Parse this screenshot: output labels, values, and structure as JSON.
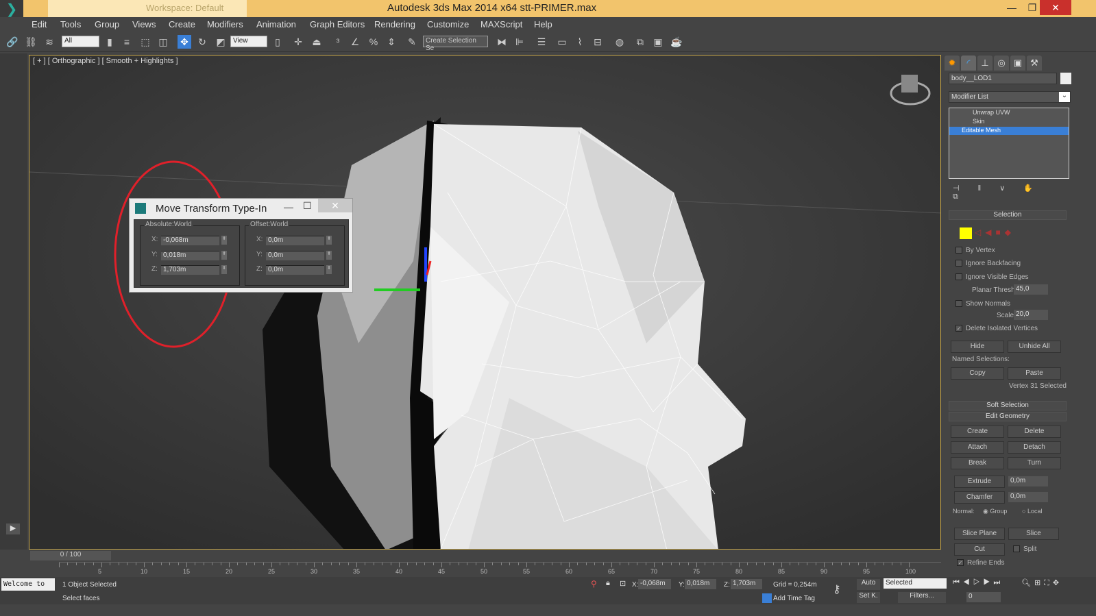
{
  "app": {
    "title": "Autodesk 3ds Max  2014 x64    stt-PRIMER.max",
    "workspace": "Workspace: Default"
  },
  "menu": [
    "Edit",
    "Tools",
    "Group",
    "Views",
    "Create",
    "Modifiers",
    "Animation",
    "Graph Editors",
    "Rendering",
    "Customize",
    "MAXScript",
    "Help"
  ],
  "toolbar": {
    "filter": "All",
    "ref_coord": "View",
    "named_sel": "Create Selection Se"
  },
  "viewport": {
    "label": "[ + ] [ Orthographic ] [ Smooth + Highlights ]"
  },
  "dialog": {
    "title": "Move Transform Type-In",
    "absolute": {
      "label": "Absolute:World",
      "x": "-0,068m",
      "y": "0,018m",
      "z": "1,703m"
    },
    "offset": {
      "label": "Offset:World",
      "x": "0,0m",
      "y": "0,0m",
      "z": "0,0m"
    },
    "axes": [
      "X:",
      "Y:",
      "Z:"
    ]
  },
  "panel": {
    "object_name": "body__LOD1",
    "modifier_list": "Modifier List",
    "stack": [
      "Unwrap UVW",
      "Skin",
      "Editable Mesh"
    ],
    "selection": {
      "title": "Selection",
      "by_vertex": "By Vertex",
      "ignore_backfacing": "Ignore Backfacing",
      "ignore_visible": "Ignore Visible Edges",
      "planar_label": "Planar Thresh:",
      "planar": "45,0",
      "show_normals": "Show Normals",
      "scale_label": "Scale:",
      "scale": "20,0",
      "delete_isolated": "Delete Isolated Vertices",
      "hide": "Hide",
      "unhide": "Unhide All",
      "named": "Named Selections:",
      "copy": "Copy",
      "paste": "Paste",
      "status": "Vertex 31 Selected"
    },
    "soft_selection": "Soft Selection",
    "edit_geometry": {
      "title": "Edit Geometry",
      "buttons": [
        "Create",
        "Delete",
        "Attach",
        "Detach",
        "Break",
        "Turn"
      ],
      "extrude": "Extrude",
      "extrude_val": "0,0m",
      "chamfer": "Chamfer",
      "chamfer_val": "0,0m",
      "normal": "Normal:",
      "group": "Group",
      "local": "Local",
      "slice_plane": "Slice Plane",
      "slice": "Slice",
      "cut": "Cut",
      "split": "Split",
      "refine": "Refine Ends"
    }
  },
  "timeline": {
    "frame": "0 / 100",
    "ticks": [
      "5",
      "10",
      "15",
      "20",
      "25",
      "30",
      "35",
      "40",
      "45",
      "50",
      "55",
      "60",
      "65",
      "70",
      "75",
      "80",
      "85",
      "90",
      "95",
      "100"
    ]
  },
  "status": {
    "welcome": "Welcome to",
    "selected": "1 Object Selected",
    "prompt": "Select faces",
    "x": "-0,068m",
    "y": "0,018m",
    "z": "1,703m",
    "grid": "Grid = 0,254m",
    "auto": "Auto",
    "setk": "Set K.",
    "key_filter": "Selected",
    "filters": "Filters...",
    "add_time_tag": "Add Time Tag",
    "frame_val": "0",
    "xl": "X:",
    "yl": "Y:",
    "zl": "Z:"
  },
  "colors": {
    "title_bar": "#f2c46c",
    "selected_modifier": "#3a7fd6",
    "annotation": "#e0202a"
  }
}
